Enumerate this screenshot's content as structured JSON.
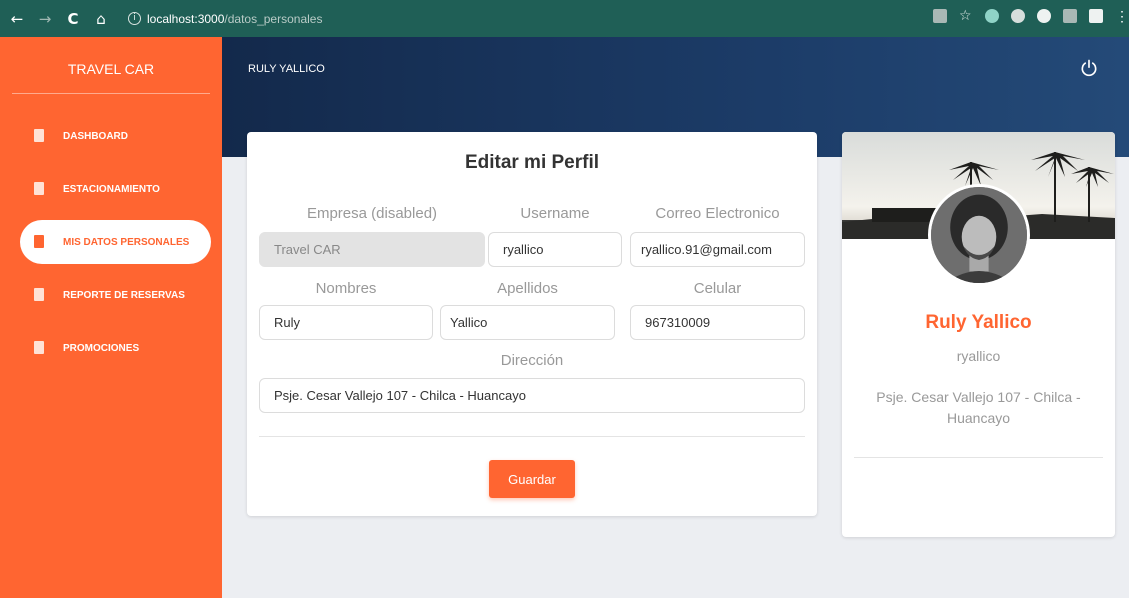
{
  "browser": {
    "back": "←",
    "forward": "→",
    "reload": "C",
    "home": "⌂",
    "info": "i",
    "url_host": "localhost:3000",
    "url_path": "/datos_personales"
  },
  "sidebar": {
    "brand": "TRAVEL CAR",
    "items": [
      {
        "label": "DASHBOARD",
        "active": false
      },
      {
        "label": "ESTACIONAMIENTO",
        "active": false
      },
      {
        "label": "MIS DATOS PERSONALES",
        "active": true
      },
      {
        "label": "REPORTE DE RESERVAS",
        "active": false
      },
      {
        "label": "PROMOCIONES",
        "active": false
      }
    ]
  },
  "header": {
    "user": "RULY YALLICO"
  },
  "form": {
    "title": "Editar mi Perfil",
    "empresa_label": "Empresa (disabled)",
    "empresa_value": "Travel CAR",
    "username_label": "Username",
    "username_value": "ryallico",
    "correo_label": "Correo Electronico",
    "correo_value": "ryallico.91@gmail.com",
    "nombres_label": "Nombres",
    "nombres_value": "Ruly",
    "apellidos_label": "Apellidos",
    "apellidos_value": "Yallico",
    "celular_label": "Celular",
    "celular_value": "967310009",
    "direccion_label": "Dirección",
    "direccion_value": "Psje. Cesar Vallejo 107 - Chilca - Huancayo",
    "save_label": "Guardar"
  },
  "profile": {
    "name": "Ruly Yallico",
    "username": "ryallico",
    "address": "Psje. Cesar Vallejo 107 - Chilca - Huancayo"
  },
  "colors": {
    "accent": "#ff6531",
    "header": "#13294b",
    "browser": "#1f5f56"
  }
}
